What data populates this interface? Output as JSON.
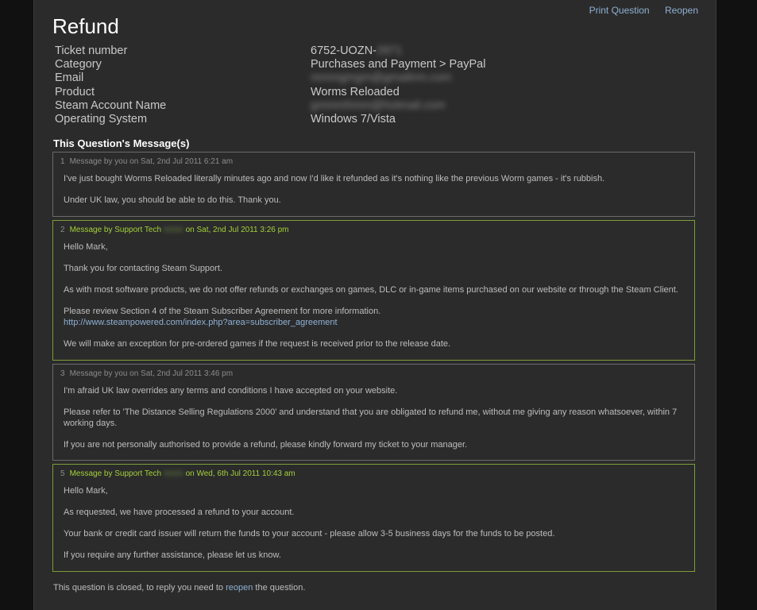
{
  "toolbar": {
    "print_label": "Print Question",
    "reopen_label": "Reopen"
  },
  "ticket": {
    "title": "Refund",
    "fields": [
      {
        "label": "Ticket number",
        "value": "6752-UOZN-",
        "redacted": "2871"
      },
      {
        "label": "Category",
        "value": "Purchases and Payment > PayPal"
      },
      {
        "label": "Email",
        "value": "",
        "redacted": "mmmgmgm@gmailnm.com"
      },
      {
        "label": "Product",
        "value": "Worms Reloaded"
      },
      {
        "label": "Steam Account Name",
        "value": "",
        "redacted": "gmmmhmm@hotmail.com"
      },
      {
        "label": "Operating System",
        "value": "Windows 7/Vista"
      }
    ]
  },
  "messages_title": "This Question's Message(s)",
  "messages": [
    {
      "num": "1",
      "prefix": "Message by you on Sat, 2nd Jul 2011 6:21 am",
      "paras": [
        "I've just bought Worms Reloaded literally minutes ago and now I'd like it refunded as it's nothing like the previous Worm games - it's rubbish.",
        "Under UK law, you should be able to do this. Thank you."
      ]
    },
    {
      "num": "2",
      "prefix": "Message by Support Tech",
      "redacted": "mmm",
      "suffix": "on Sat, 2nd Jul 2011 3:26 pm",
      "paras": [
        "Hello Mark,",
        "Thank you for contacting Steam Support.",
        "As with most software products, we do not offer refunds or exchanges on games, DLC or in-game items purchased on our website or through the Steam Client.",
        "Please review Section 4 of the Steam Subscriber Agreement for more information.",
        "We will make an exception for pre-ordered games if the request is received prior to the release date."
      ],
      "link": "http://www.steampowered.com/index.php?area=subscriber_agreement"
    },
    {
      "num": "3",
      "prefix": "Message by you on Sat, 2nd Jul 2011 3:46 pm",
      "paras": [
        "I'm afraid UK law overrides any terms and conditions I have accepted on your website.",
        "Please refer to 'The Distance Selling Regulations 2000' and understand that you are obligated to refund me, without me giving any reason whatsoever, within 7 working days.",
        "If you are not personally authorised to provide a refund, please kindly forward my ticket to your manager."
      ]
    },
    {
      "num": "5",
      "prefix": "Message by Support Tech",
      "redacted": "mmm",
      "suffix": "on Wed, 6th Jul 2011 10:43 am",
      "paras": [
        "Hello Mark,",
        "As requested, we have processed a refund to your account.",
        "Your bank or credit card issuer will return the funds to your account - please allow 3-5 business days for the funds to be posted.",
        "If you require any further assistance, please let us know."
      ]
    }
  ],
  "closed": {
    "before": "This question is closed, to reply you need to",
    "link": "reopen",
    "after": "the question."
  },
  "colors": {
    "page_bg": "#2b2b2b",
    "outer_bg": "#111111",
    "link": "#8fb0d4",
    "support_accent": "#a4d03a",
    "support_border": "#7a9e38"
  }
}
